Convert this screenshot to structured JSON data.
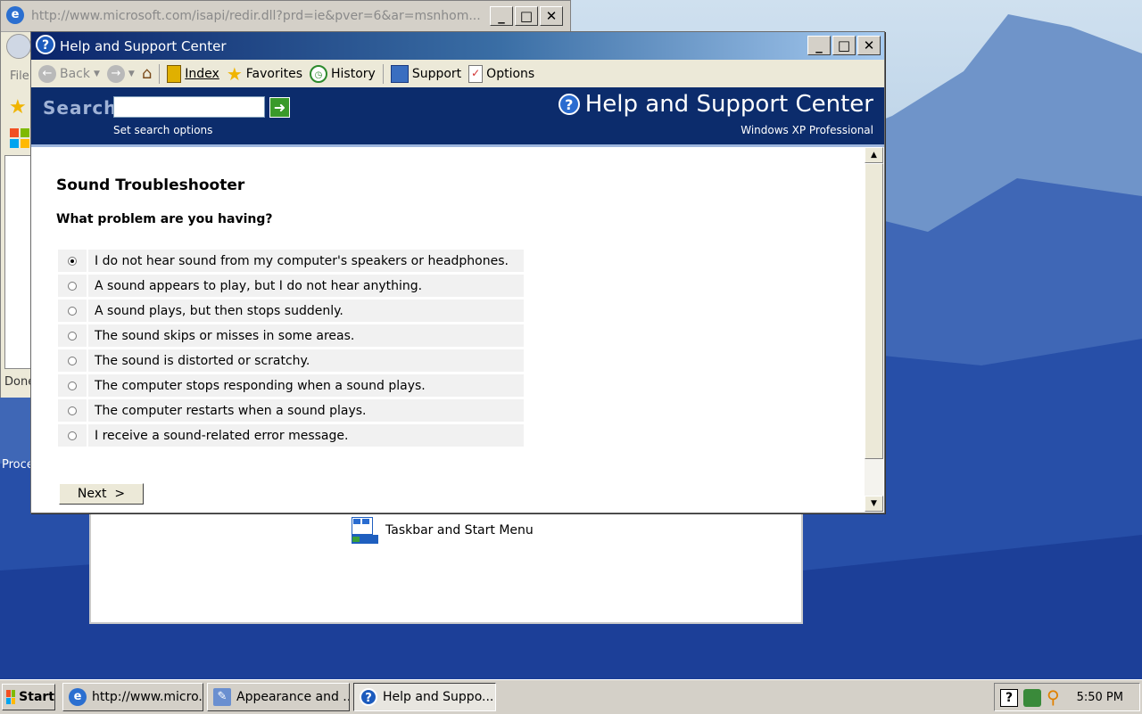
{
  "ie_window": {
    "title": "http://www.microsoft.com/isapi/redir.dll?prd=ie&pver=6&ar=msnhom...",
    "menu_file": "File",
    "status": "Done"
  },
  "desktop_text": "Proce",
  "control_panel": {
    "item_label": "Taskbar and Start Menu"
  },
  "help_center": {
    "title": "Help and Support Center",
    "toolbar": {
      "back": "Back",
      "index": "Index",
      "favorites": "Favorites",
      "history": "History",
      "support": "Support",
      "options": "Options"
    },
    "header": {
      "search_label": "Search",
      "search_value": "",
      "search_options": "Set search options",
      "brand": "Help and Support Center",
      "edition": "Windows XP Professional"
    },
    "content": {
      "title": "Sound Troubleshooter",
      "question": "What problem are you having?",
      "options": [
        {
          "label": "I do not hear sound from my computer's speakers or headphones.",
          "selected": true
        },
        {
          "label": "A sound appears to play, but I do not hear anything.",
          "selected": false
        },
        {
          "label": "A sound plays, but then stops suddenly.",
          "selected": false
        },
        {
          "label": "The sound skips or misses in some areas.",
          "selected": false
        },
        {
          "label": "The sound is distorted or scratchy.",
          "selected": false
        },
        {
          "label": "The computer stops responding when a sound plays.",
          "selected": false
        },
        {
          "label": "The computer restarts when a sound plays.",
          "selected": false
        },
        {
          "label": "I receive a sound-related error message.",
          "selected": false
        }
      ],
      "next_button": "Next  >"
    }
  },
  "taskbar": {
    "start": "Start",
    "tasks": [
      {
        "label": "http://www.micro...",
        "icon": "ie-icon"
      },
      {
        "label": "Appearance and ...",
        "icon": "control-panel-icon"
      },
      {
        "label": "Help and Suppo...",
        "icon": "help-icon",
        "active": true
      }
    ],
    "clock": "5:50 PM"
  },
  "colors": {
    "titlebar_active": "#0a246a",
    "header_bg": "#0c2c6c",
    "option_bg": "#f1f1f1",
    "taskbar_bg": "#d4d0c8"
  }
}
